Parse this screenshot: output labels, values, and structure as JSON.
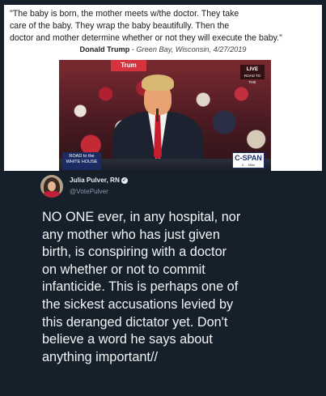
{
  "quote_card": {
    "lines": [
      "\"The baby is born, the mother meets w/the doctor. They take",
      "care of the baby. They wrap the baby beautifully. Then the",
      "doctor and mother determine whether or not they will execute the baby.\""
    ],
    "speaker": "Donald Trump",
    "separator": " - ",
    "location_date": "Green Bay, Wisconsin, 4/27/2019"
  },
  "video": {
    "sign_text": "Trum",
    "live_label": "LIVE",
    "live_sub": "ROAD TO THE",
    "banner_lines": [
      "ROAD to the",
      "WHITE HOUSE"
    ],
    "network_logo": "C-SPAN",
    "network_sub": "3 ... Mike"
  },
  "tweet": {
    "author_name": "Julia Pulver, RN",
    "handle": "@VotePulver",
    "body_lines": [
      "NO ONE ever, in any hospital, nor",
      "any mother who has just given",
      "birth, is conspiring with a doctor",
      "on whether or not to commit",
      "infanticide. This is perhaps one of",
      "the sickest accusations levied by",
      "this deranged dictator yet. Don't",
      "believe a word he says about",
      "anything important//"
    ],
    "verified_icon": "verified-badge-icon",
    "avatar_icon": "profile-photo"
  },
  "colors": {
    "background": "#15202b",
    "text_primary": "#f2f4f6",
    "text_secondary": "#8899a6",
    "tie_red": "#c91c2e"
  }
}
